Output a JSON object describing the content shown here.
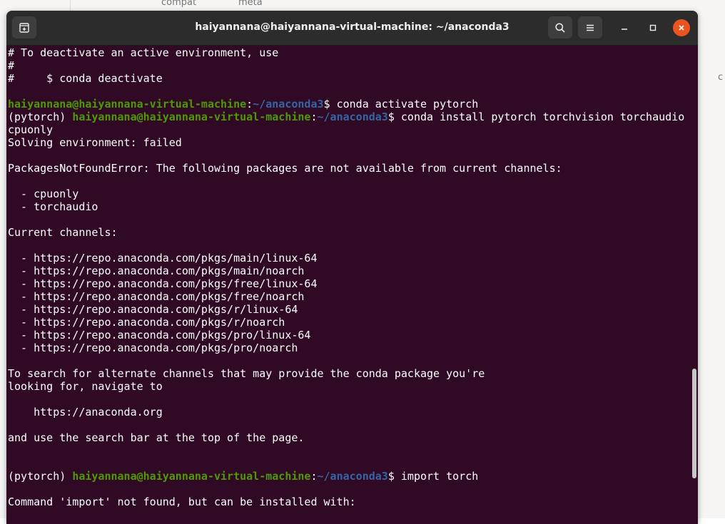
{
  "background": {
    "label_compat": "compat",
    "label_meta": "meta",
    "label_right": "c"
  },
  "window": {
    "title": "haiyannana@haiyannana-virtual-machine: ~/anaconda3",
    "icons": {
      "new_tab": "new-tab-icon",
      "search": "search-icon",
      "menu": "hamburger-menu-icon",
      "minimize": "minimize-icon",
      "maximize": "maximize-icon",
      "close": "close-icon"
    },
    "colors": {
      "terminal_bg": "#300a24",
      "titlebar_bg": "#2c2c2c",
      "prompt_user": "#4e9a06",
      "prompt_path": "#3465a4",
      "close_button": "#e95420"
    }
  },
  "terminal": {
    "lines": [
      {
        "text": "# To deactivate an active environment, use"
      },
      {
        "text": "#"
      },
      {
        "text": "#     $ conda deactivate"
      },
      {
        "text": ""
      },
      {
        "prefix": "",
        "user": "haiyannana@haiyannana-virtual-machine",
        "sep": ":",
        "path": "~/anaconda3",
        "cmd": "$ conda activate pytorch"
      },
      {
        "prefix": "(pytorch) ",
        "user": "haiyannana@haiyannana-virtual-machine",
        "sep": ":",
        "path": "~/anaconda3",
        "cmd": "$ conda install pytorch torchvision torchaudio"
      },
      {
        "text": "cpuonly"
      },
      {
        "text": "Solving environment: failed"
      },
      {
        "text": ""
      },
      {
        "text": "PackagesNotFoundError: The following packages are not available from current channels:"
      },
      {
        "text": ""
      },
      {
        "text": "  - cpuonly"
      },
      {
        "text": "  - torchaudio"
      },
      {
        "text": ""
      },
      {
        "text": "Current channels:"
      },
      {
        "text": ""
      },
      {
        "text": "  - https://repo.anaconda.com/pkgs/main/linux-64"
      },
      {
        "text": "  - https://repo.anaconda.com/pkgs/main/noarch"
      },
      {
        "text": "  - https://repo.anaconda.com/pkgs/free/linux-64"
      },
      {
        "text": "  - https://repo.anaconda.com/pkgs/free/noarch"
      },
      {
        "text": "  - https://repo.anaconda.com/pkgs/r/linux-64"
      },
      {
        "text": "  - https://repo.anaconda.com/pkgs/r/noarch"
      },
      {
        "text": "  - https://repo.anaconda.com/pkgs/pro/linux-64"
      },
      {
        "text": "  - https://repo.anaconda.com/pkgs/pro/noarch"
      },
      {
        "text": ""
      },
      {
        "text": "To search for alternate channels that may provide the conda package you're"
      },
      {
        "text": "looking for, navigate to"
      },
      {
        "text": ""
      },
      {
        "text": "    https://anaconda.org"
      },
      {
        "text": ""
      },
      {
        "text": "and use the search bar at the top of the page."
      },
      {
        "text": ""
      },
      {
        "text": ""
      },
      {
        "prefix": "(pytorch) ",
        "user": "haiyannana@haiyannana-virtual-machine",
        "sep": ":",
        "path": "~/anaconda3",
        "cmd": "$ import torch"
      },
      {
        "text": ""
      },
      {
        "text": "Command 'import' not found, but can be installed with:"
      }
    ]
  }
}
